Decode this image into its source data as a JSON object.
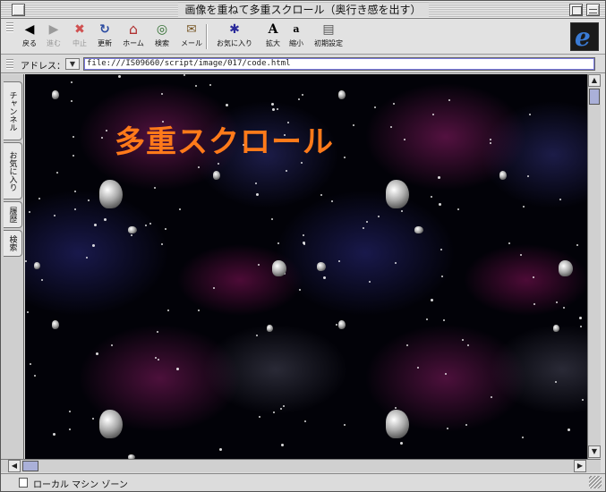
{
  "window": {
    "title": "画像を重ねて多重スクロール（奥行き感を出す）"
  },
  "toolbar": {
    "buttons": [
      {
        "label": "戻る",
        "icon": "back-arrow-icon",
        "glyph": "◀",
        "enabled": true
      },
      {
        "label": "進む",
        "icon": "forward-arrow-icon",
        "glyph": "▶",
        "enabled": false
      },
      {
        "label": "中止",
        "icon": "stop-icon",
        "glyph": "✖",
        "enabled": false
      },
      {
        "label": "更新",
        "icon": "refresh-icon",
        "glyph": "↻",
        "enabled": true
      },
      {
        "label": "ホーム",
        "icon": "home-icon",
        "glyph": "⌂",
        "enabled": true
      },
      {
        "label": "検索",
        "icon": "search-icon",
        "glyph": "◎",
        "enabled": true
      },
      {
        "label": "メール",
        "icon": "mail-icon",
        "glyph": "✉",
        "enabled": true
      },
      {
        "label": "お気に入り",
        "icon": "favorites-icon",
        "glyph": "✱",
        "enabled": true
      },
      {
        "label": "拡大",
        "icon": "text-larger-icon",
        "glyph": "A",
        "enabled": true
      },
      {
        "label": "縮小",
        "icon": "text-smaller-icon",
        "glyph": "a",
        "enabled": true
      },
      {
        "label": "初期設定",
        "icon": "preferences-icon",
        "glyph": "▤",
        "enabled": true
      }
    ]
  },
  "address": {
    "label": "アドレス：",
    "url": "file:///IS09660/script/image/017/code.html"
  },
  "sidebar": {
    "tabs": [
      "チャンネル",
      "お気に入り",
      "履歴",
      "検索"
    ]
  },
  "page": {
    "headline": "多重スクロール",
    "headline_color": "#ff7a1a"
  },
  "status": {
    "text": "ローカル マシン ゾーン"
  }
}
